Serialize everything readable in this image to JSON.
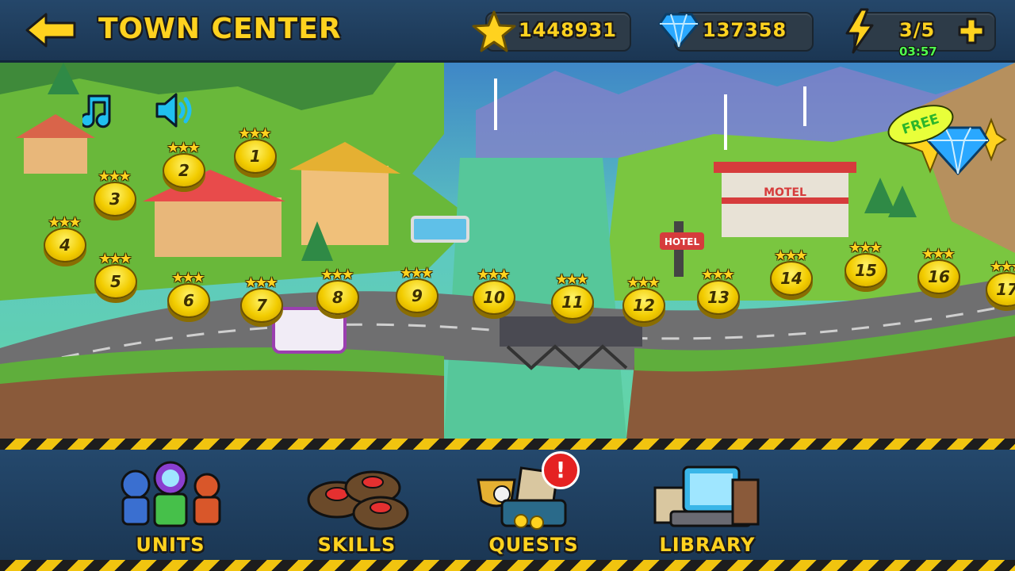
{
  "header": {
    "title": "TOWN CENTER",
    "stars_count": "1448931",
    "gems_count": "137358",
    "energy": "3/5",
    "energy_timer": "03:57"
  },
  "map": {
    "free_badge": "FREE",
    "motel_sign": "MOTEL",
    "hotel_sign": "HOTEL",
    "levels": [
      "1",
      "2",
      "3",
      "4",
      "5",
      "6",
      "7",
      "8",
      "9",
      "10",
      "11",
      "12",
      "13",
      "14",
      "15",
      "16",
      "17"
    ]
  },
  "menu": {
    "units": "UNITS",
    "skills": "SKILLS",
    "quests": "QUESTS",
    "library": "LIBRARY"
  },
  "icons": {
    "back": "back-arrow-icon",
    "star": "star-icon",
    "gem": "gem-icon",
    "energy": "lightning-icon",
    "plus": "plus-icon",
    "music": "music-note-icon",
    "sound": "speaker-icon",
    "alert": "exclamation-badge-icon"
  },
  "colors": {
    "accent_yellow": "#ffd21f",
    "panel_blue": "#1f3f5f",
    "timer_green": "#4fff4f",
    "gem_blue": "#2aa8ff"
  }
}
